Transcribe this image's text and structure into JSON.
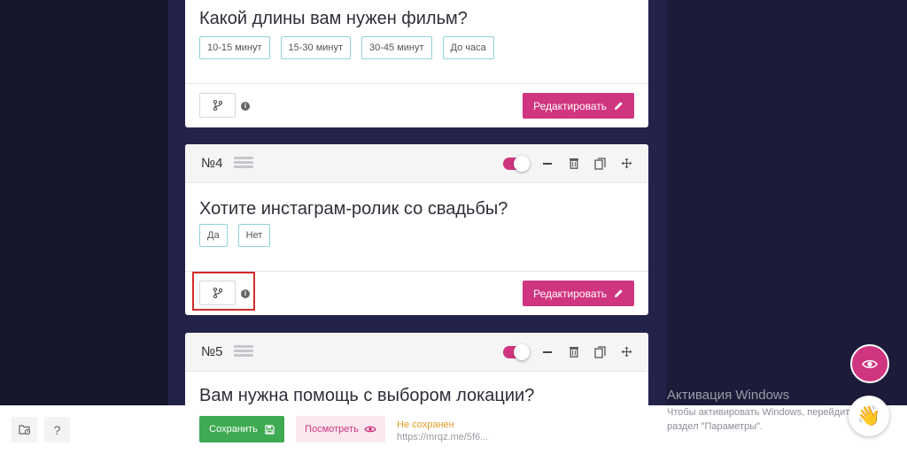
{
  "questions": [
    {
      "text": "Какой длины вам нужен фильм?",
      "answers": [
        "10-15 минут",
        "15-30 минут",
        "30-45 минут",
        "До часа"
      ],
      "edit_label": "Редактировать"
    },
    {
      "number": "№4",
      "text": "Хотите инстаграм-ролик со свадьбы?",
      "answers": [
        "Да",
        "Нет"
      ],
      "edit_label": "Редактировать",
      "enabled": true
    },
    {
      "number": "№5",
      "text": "Вам нужна помощь с выбором локации?",
      "enabled": true
    }
  ],
  "footer": {
    "help_label": "?",
    "save_label": "Сохранить",
    "preview_label": "Посмотреть",
    "status": "Не сохранен",
    "url": "https://mrqz.me/5f6..."
  },
  "watermark": {
    "title": "Активация Windows",
    "subtitle": "Чтобы активировать Windows, перейдите в раздел \"Параметры\"."
  },
  "colors": {
    "accent": "#d0357f",
    "save": "#3eaa52",
    "answer_border": "#8fd3da",
    "status_warning": "#e39a1e",
    "highlight": "#d32b2b"
  },
  "icons": {
    "branch": "branch-icon",
    "info": "info-icon",
    "pencil": "pencil-icon",
    "minus": "minus-icon",
    "trash": "trash-icon",
    "copy": "copy-icon",
    "move": "move-icon",
    "eye": "eye-icon",
    "wave": "waving-hand-icon"
  }
}
